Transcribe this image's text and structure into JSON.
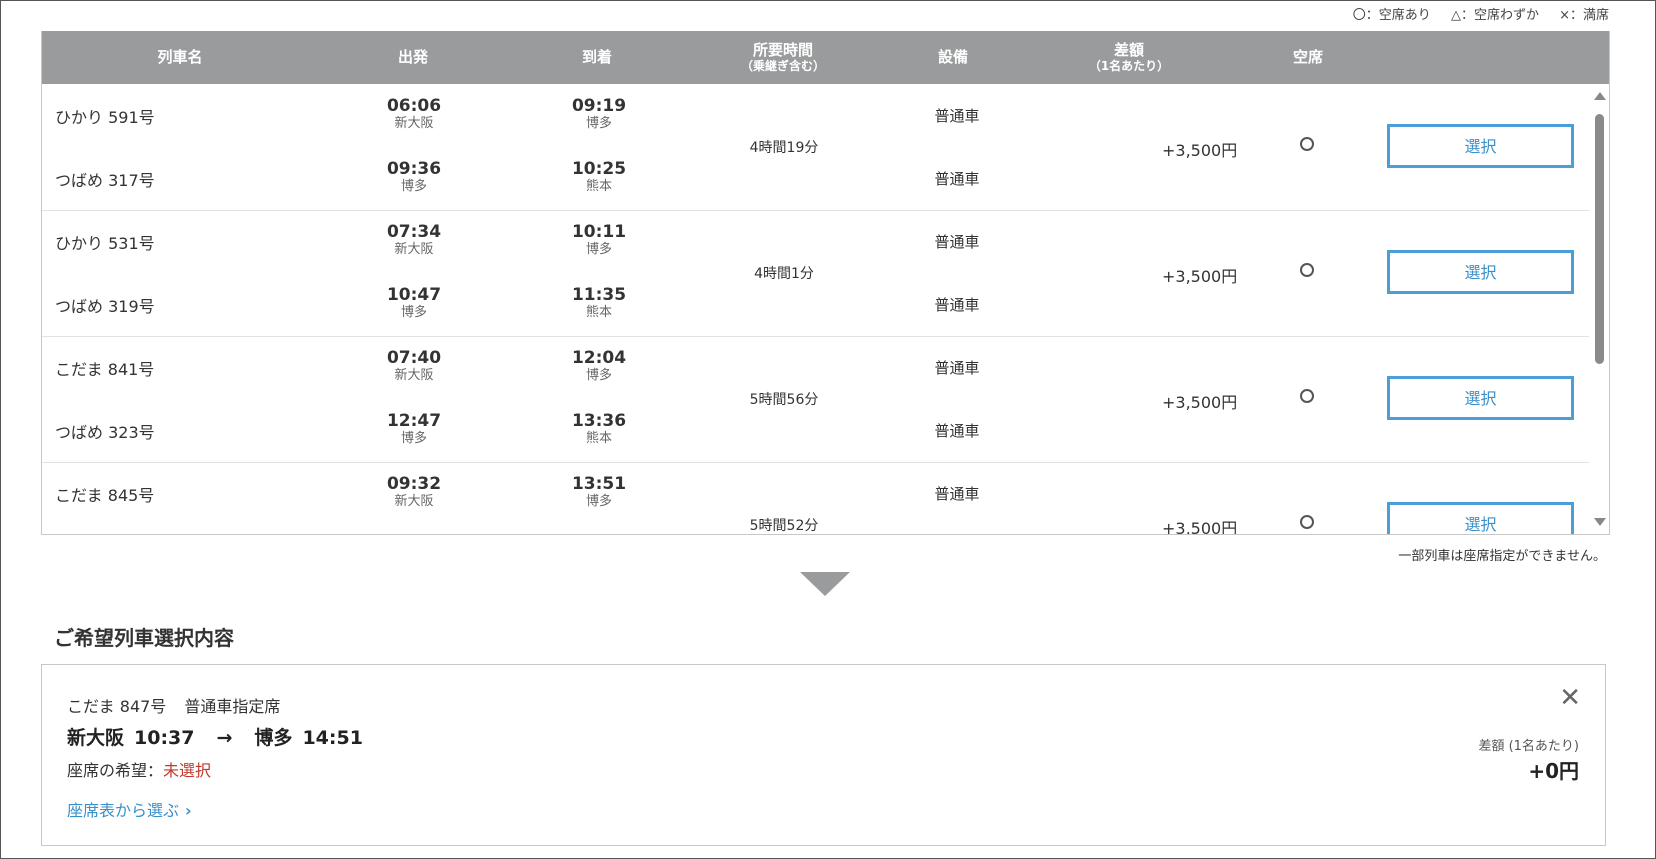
{
  "legend": {
    "available": "〇：空席あり",
    "few": "△：空席わずか",
    "full": "×：満席"
  },
  "table": {
    "headers": {
      "train": "列車名",
      "departure": "出発",
      "arrival": "到着",
      "duration": "所要時間",
      "duration_sub": "（乗継ぎ含む）",
      "facility": "設備",
      "price": "差額",
      "price_sub": "（1名あたり）",
      "vacancy": "空席"
    },
    "rows": [
      {
        "legs": [
          {
            "train": "ひかり 591号",
            "dep_time": "06:06",
            "dep_station": "新大阪",
            "arr_time": "09:19",
            "arr_station": "博多",
            "facility": "普通車"
          },
          {
            "train": "つばめ 317号",
            "dep_time": "09:36",
            "dep_station": "博多",
            "arr_time": "10:25",
            "arr_station": "熊本",
            "facility": "普通車"
          }
        ],
        "duration": "4時間19分",
        "price": "+3,500円",
        "select": "選択"
      },
      {
        "legs": [
          {
            "train": "ひかり 531号",
            "dep_time": "07:34",
            "dep_station": "新大阪",
            "arr_time": "10:11",
            "arr_station": "博多",
            "facility": "普通車"
          },
          {
            "train": "つばめ 319号",
            "dep_time": "10:47",
            "dep_station": "博多",
            "arr_time": "11:35",
            "arr_station": "熊本",
            "facility": "普通車"
          }
        ],
        "duration": "4時間1分",
        "price": "+3,500円",
        "select": "選択"
      },
      {
        "legs": [
          {
            "train": "こだま 841号",
            "dep_time": "07:40",
            "dep_station": "新大阪",
            "arr_time": "12:04",
            "arr_station": "博多",
            "facility": "普通車"
          },
          {
            "train": "つばめ 323号",
            "dep_time": "12:47",
            "dep_station": "博多",
            "arr_time": "13:36",
            "arr_station": "熊本",
            "facility": "普通車"
          }
        ],
        "duration": "5時間56分",
        "price": "+3,500円",
        "select": "選択"
      },
      {
        "legs": [
          {
            "train": "こだま 845号",
            "dep_time": "09:32",
            "dep_station": "新大阪",
            "arr_time": "13:51",
            "arr_station": "博多",
            "facility": "普通車"
          }
        ],
        "duration": "5時間52分",
        "price": "+3,500円",
        "select": "選択"
      }
    ]
  },
  "note": "一部列車は座席指定ができません。",
  "selection": {
    "title": "ご希望列車選択内容",
    "train": "こだま 847号",
    "class": "普通車指定席",
    "from": "新大阪",
    "dep_time": "10:37",
    "arrow": "→",
    "to": "博多",
    "arr_time": "14:51",
    "seat_label": "座席の希望：",
    "seat_value": "未選択",
    "seat_link": "座席表から選ぶ",
    "diff_label": "差額 (1名あたり)",
    "diff_value": "+0円"
  }
}
